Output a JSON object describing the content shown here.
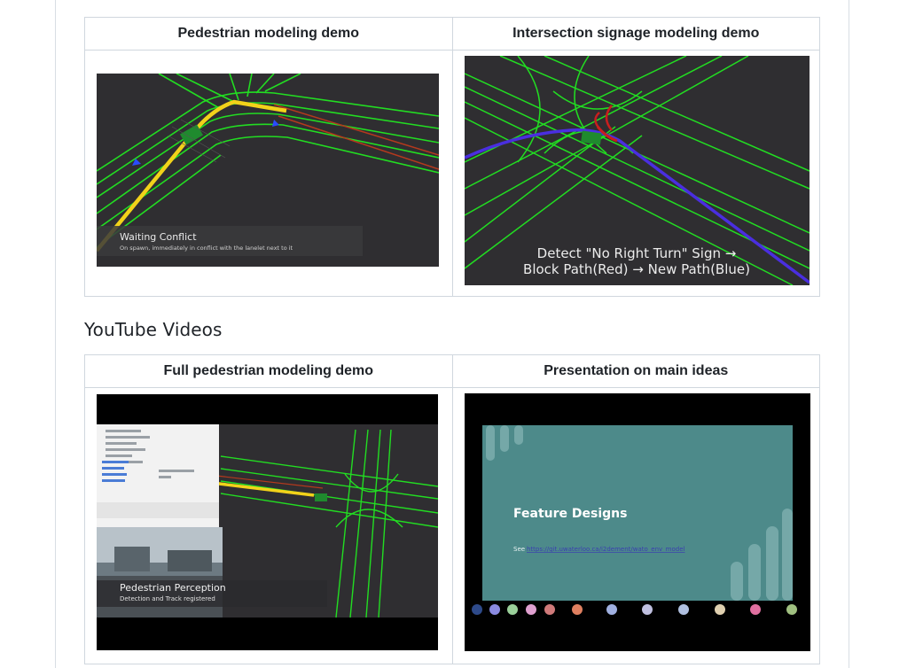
{
  "table1": {
    "headers": [
      "Pedestrian modeling demo",
      "Intersection signage modeling demo"
    ]
  },
  "gif_pedestrian": {
    "caption_title": "Waiting Conflict",
    "caption_sub": "On spawn, immediately in conflict with the lanelet next to it"
  },
  "gif_signage": {
    "caption_line1": "Detect \"No Right Turn\" Sign →",
    "caption_line2": "Block Path(Red) → New Path(Blue)"
  },
  "section_title": "YouTube Videos",
  "table2": {
    "headers": [
      "Full pedestrian modeling demo",
      "Presentation on main ideas"
    ]
  },
  "video_pedestrian": {
    "overlay_title": "Pedestrian Perception",
    "overlay_sub": "Detection and Track registered"
  },
  "video_presentation": {
    "slide_title": "Feature Designs",
    "slide_see_label": "See",
    "slide_link": "https://git.uwaterloo.ca/i2dement/wato_env_model"
  },
  "colors": {
    "lane_green": "#22dd22",
    "path_yellow": "#f2d21a",
    "block_red": "#c81e1e",
    "path_blue": "#4a2ee0",
    "sim_bg": "#2f2e31",
    "slide_teal": "#4d8a8a",
    "table_border": "#d0d7de"
  }
}
